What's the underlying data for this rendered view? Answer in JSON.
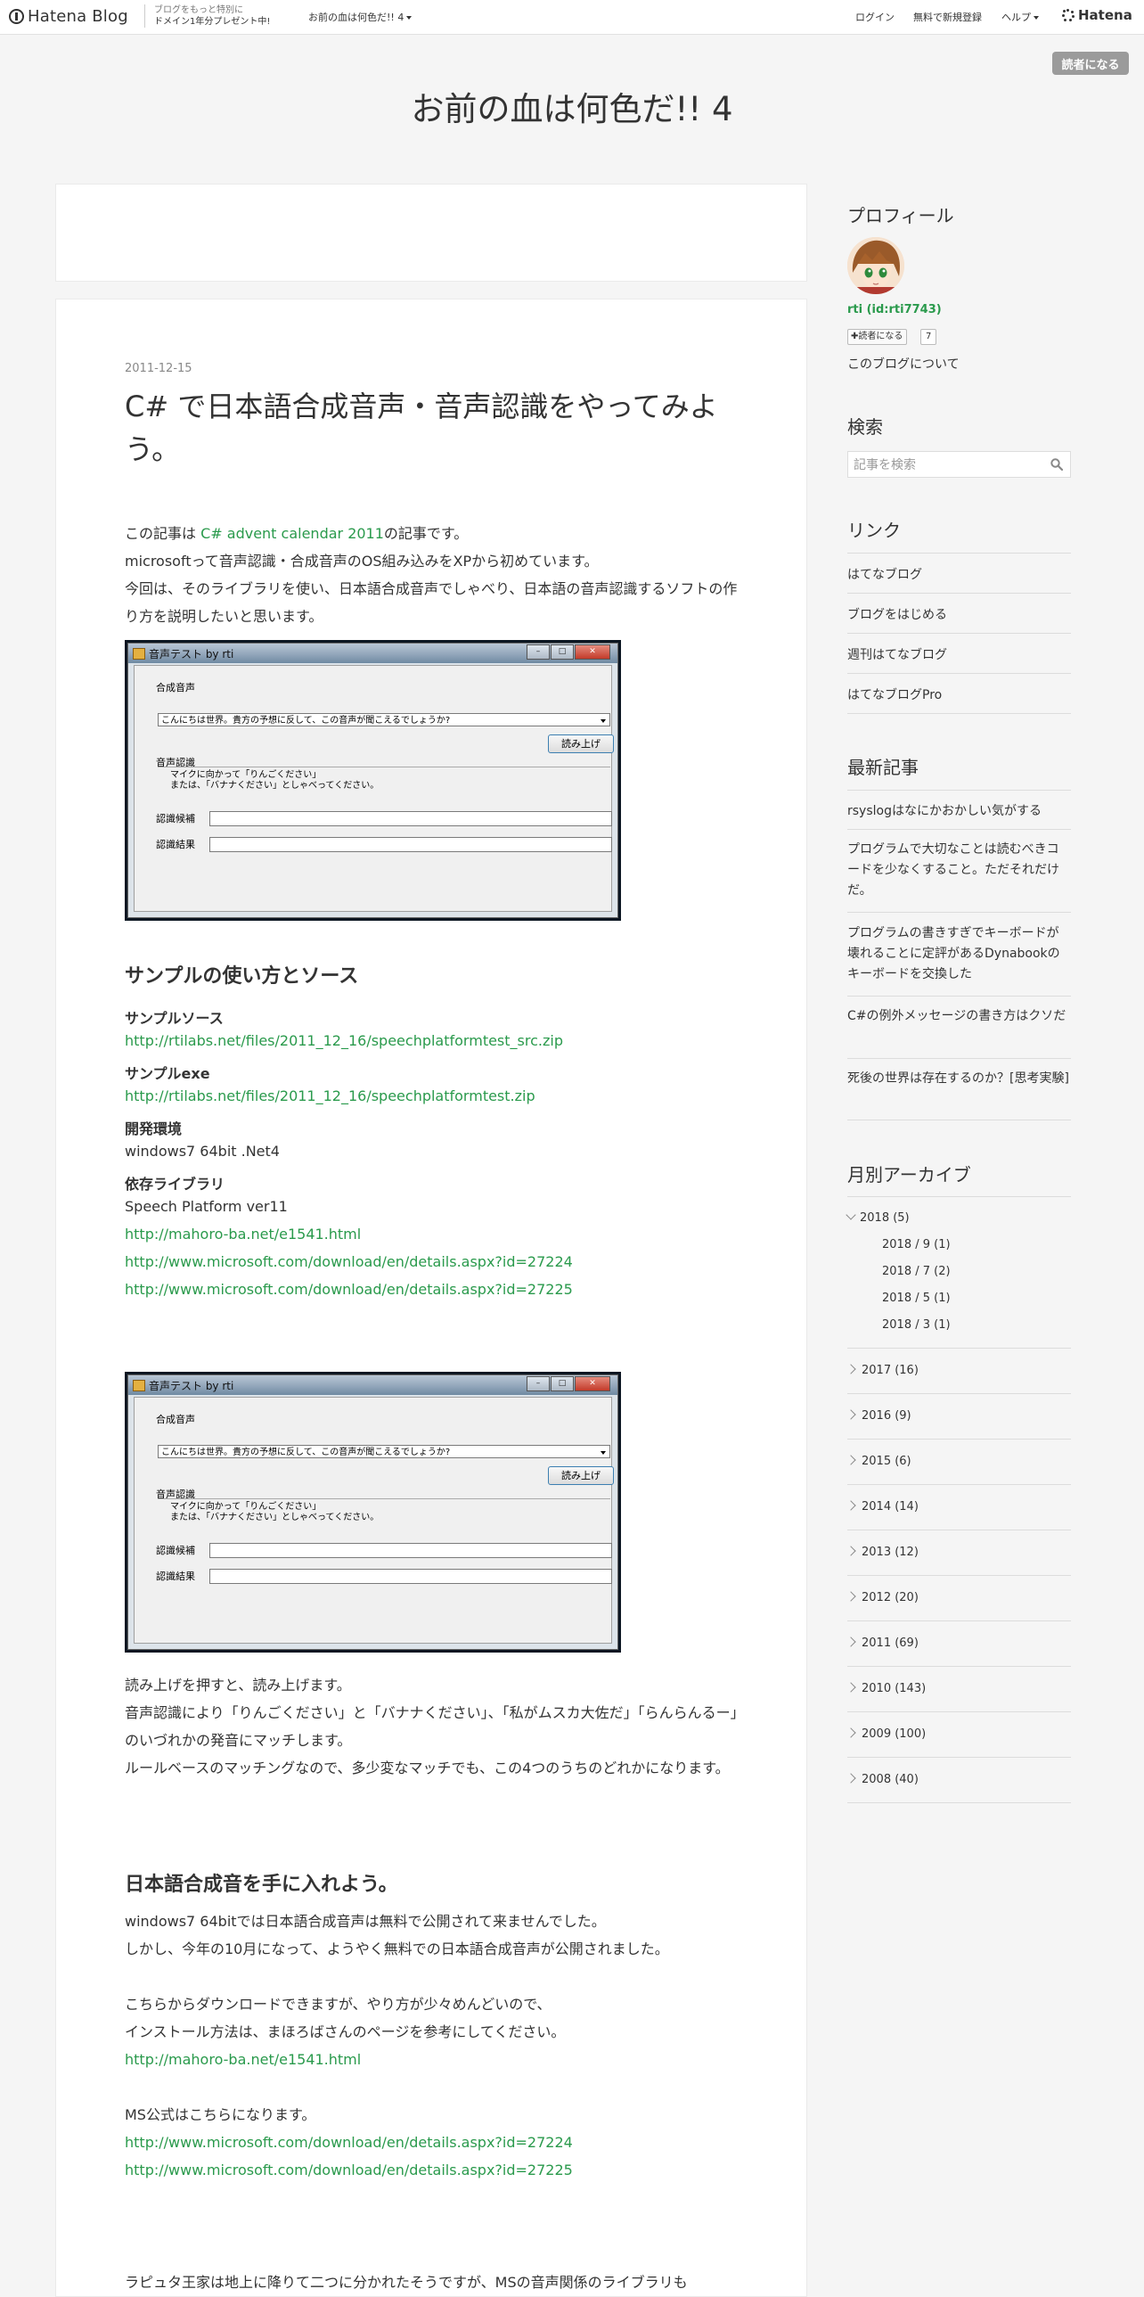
{
  "header": {
    "logo": "Hatena Blog",
    "promo_line1": "ブログをもっと特別に",
    "promo_line2": "ドメイン1年分プレゼント中!",
    "blog_dropdown": "お前の血は何色だ!! 4",
    "login": "ログイン",
    "signup": "無料で新規登録",
    "help": "ヘルプ",
    "hatena": "Hatena"
  },
  "subscribe_button": "読者になる",
  "blog_title": "お前の血は何色だ!! 4",
  "entry": {
    "date": "2011-12-15",
    "title": "C# で日本語合成音声・音声認識をやってみよう。",
    "intro_prefix": "この記事は ",
    "intro_link": "C# advent calendar 2011",
    "intro_suffix": "の記事です。",
    "intro_line2": "microsoftって音声認識・合成音声のOS組み込みをXPから初めています。",
    "intro_line3": "今回は、そのライブラリを使い、日本語合成音声でしゃべり、日本語の音声認識するソフトの作り方を説明したいと思います。",
    "app_window": {
      "title": "音声テスト by rti",
      "section_tts": "合成音声",
      "combo_text": "こんにちは世界。貴方の予想に反して、この音声が聞こえるでしょうか?",
      "read_button": "読み上げ",
      "section_sr": "音声認識",
      "sr_hint_line1": "マイクに向かって「りんごください」",
      "sr_hint_line2": "または、「バナナください」としゃべってください。",
      "candidate_label": "認識候補",
      "result_label": "認識結果"
    },
    "section1_heading": "サンプルの使い方とソース",
    "src_label": "サンプルソース",
    "src_link": "http://rtilabs.net/files/2011_12_16/speechplatformtest_src.zip",
    "exe_label": "サンプルexe",
    "exe_link": "http://rtilabs.net/files/2011_12_16/speechplatformtest.zip",
    "env_label": "開発環境",
    "env_value": "windows7 64bit .Net4",
    "dep_label": "依存ライブラリ",
    "dep_value": "Speech Platform ver11",
    "dep_link1": "http://mahoro-ba.net/e1541.html",
    "dep_link2": "http://www.microsoft.com/download/en/details.aspx?id=27224",
    "dep_link3": "http://www.microsoft.com/download/en/details.aspx?id=27225",
    "para2_line1": "読み上げを押すと、読み上げます。",
    "para2_line2": "音声認識により「りんごください」と「バナナください」、「私がムスカ大佐だ」「らんらんるー」のいづれかの発音にマッチします。",
    "para2_line3": "ルールベースのマッチングなので、多少変なマッチでも、この4つのうちのどれかになります。",
    "section2_heading": "日本語合成音を手に入れよう。",
    "para3_line1": "windows7 64bitでは日本語合成音声は無料で公開されて来ませんでした。",
    "para3_line2": "しかし、今年の10月になって、ようやく無料での日本語合成音声が公開されました。",
    "para4_line1": "こちらからダウンロードできますが、やり方が少々めんどいので、",
    "para4_line2": "インストール方法は、まほろばさんのページを参考にしてください。",
    "para4_link": "http://mahoro-ba.net/e1541.html",
    "para5_line1": "MS公式はこちらになります。",
    "para5_link1": "http://www.microsoft.com/download/en/details.aspx?id=27224",
    "para5_link2": "http://www.microsoft.com/download/en/details.aspx?id=27225",
    "para6_line1": "ラピュタ王家は地上に降りて二つに分かれたそうですが、MSの音声関係のライブラリも"
  },
  "sidebar": {
    "profile_heading": "プロフィール",
    "profile_name": "rti (id:rti7743)",
    "reader_button": "読者になる",
    "reader_count": "7",
    "about_link": "このブログについて",
    "search_heading": "検索",
    "search_placeholder": "記事を検索",
    "links_heading": "リンク",
    "links": [
      "はてなブログ",
      "ブログをはじめる",
      "週刊はてなブログ",
      "はてなブログPro"
    ],
    "recent_heading": "最新記事",
    "recent": [
      "rsyslogはなにかおかしい気がする",
      "プログラムで大切なことは読むべきコードを少なくすること。ただそれだけだ。",
      "プログラムの書きすぎでキーボードが壊れることに定評があるDynabookのキーボードを交換した",
      "C#の例外メッセージの書き方はクソだ",
      "死後の世界は存在するのか？[思考実験]"
    ],
    "archive_heading": "月別アーカイブ",
    "archive_2018": "2018 (5)",
    "archive_2018_months": [
      "2018 / 9 (1)",
      "2018 / 7 (2)",
      "2018 / 5 (1)",
      "2018 / 3 (1)"
    ],
    "archive_years": [
      "2017 (16)",
      "2016 (9)",
      "2015 (6)",
      "2014 (14)",
      "2013 (12)",
      "2012 (20)",
      "2011 (69)",
      "2010 (143)",
      "2009 (100)",
      "2008 (40)"
    ]
  }
}
